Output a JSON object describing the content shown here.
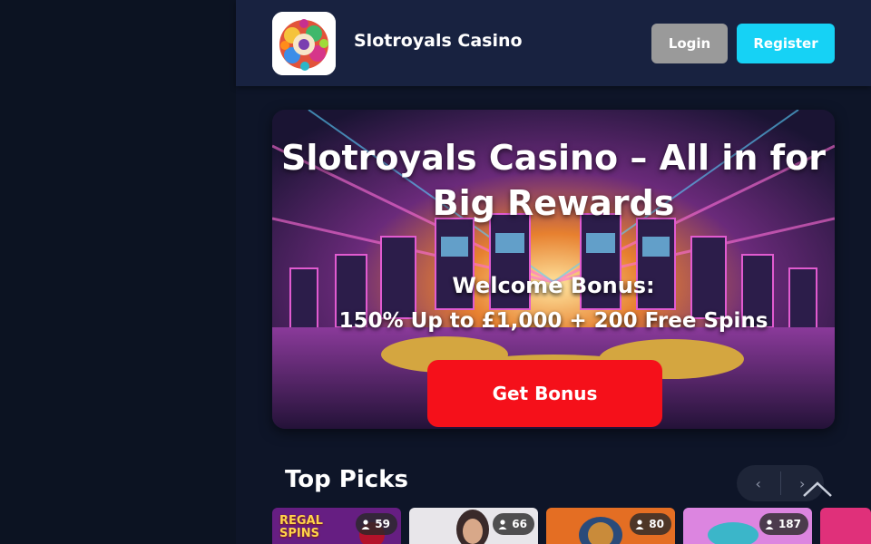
{
  "header": {
    "brand": "Slotroyals Casino",
    "login_label": "Login",
    "register_label": "Register"
  },
  "hero": {
    "title_line1": "Slotroyals Casino – All in for",
    "title_line2": "Big Rewards",
    "bonus_line1": "Welcome Bonus:",
    "bonus_line2": "150% Up to £1,000 + 200 Free Spins",
    "cta_label": "Get Bonus"
  },
  "top_picks": {
    "title": "Top Picks",
    "prev_arrow": "‹",
    "next_arrow": "›",
    "games": [
      {
        "label_line1": "REGAL",
        "label_line2": "SPINS",
        "players": "59"
      },
      {
        "players": "66"
      },
      {
        "players": "80"
      },
      {
        "players": "187"
      }
    ]
  },
  "colors": {
    "page_bg": "#0e1528",
    "header_bg": "#182240",
    "login_bg": "#9a9a9a",
    "register_bg": "#16d2f5",
    "cta_bg": "#f5101a"
  }
}
